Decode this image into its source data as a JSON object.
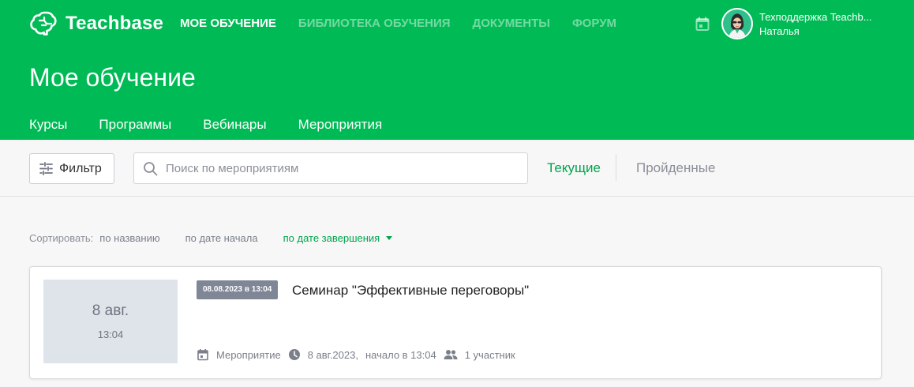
{
  "brand": {
    "name": "Teachbase",
    "accent": "#00bb55"
  },
  "topnav": [
    {
      "label": "МОЕ ОБУЧЕНИЕ",
      "active": true
    },
    {
      "label": "БИБЛИОТЕКА ОБУЧЕНИЯ",
      "active": false
    },
    {
      "label": "ДОКУМЕНТЫ",
      "active": false
    },
    {
      "label": "ФОРУМ",
      "active": false
    }
  ],
  "user": {
    "line1": "Техподдержка Teachb...",
    "line2": "Наталья",
    "avatar_icon": "avatar-woman"
  },
  "page_title": "Мое обучение",
  "tabs": [
    {
      "label": "Курсы"
    },
    {
      "label": "Программы"
    },
    {
      "label": "Вебинары"
    },
    {
      "label": "Мероприятия",
      "active": true
    }
  ],
  "toolbar": {
    "filter_label": "Фильтр",
    "search_placeholder": "Поиск по мероприятиям",
    "segment_current": "Текущие",
    "segment_past": "Пройденные"
  },
  "sort": {
    "label": "Сортировать:",
    "options": [
      "по названию",
      "по дате начала",
      "по дате завершения"
    ],
    "active_index": 2
  },
  "event": {
    "thumb_date": "8 авг.",
    "thumb_time": "13:04",
    "badge": "08.08.2023 в 13:04",
    "title": "Семинар \"Эффективные переговоры\"",
    "type": "Мероприятие",
    "date": "8 авг.2023,",
    "start": "начало в 13:04",
    "participants": "1 участник"
  }
}
